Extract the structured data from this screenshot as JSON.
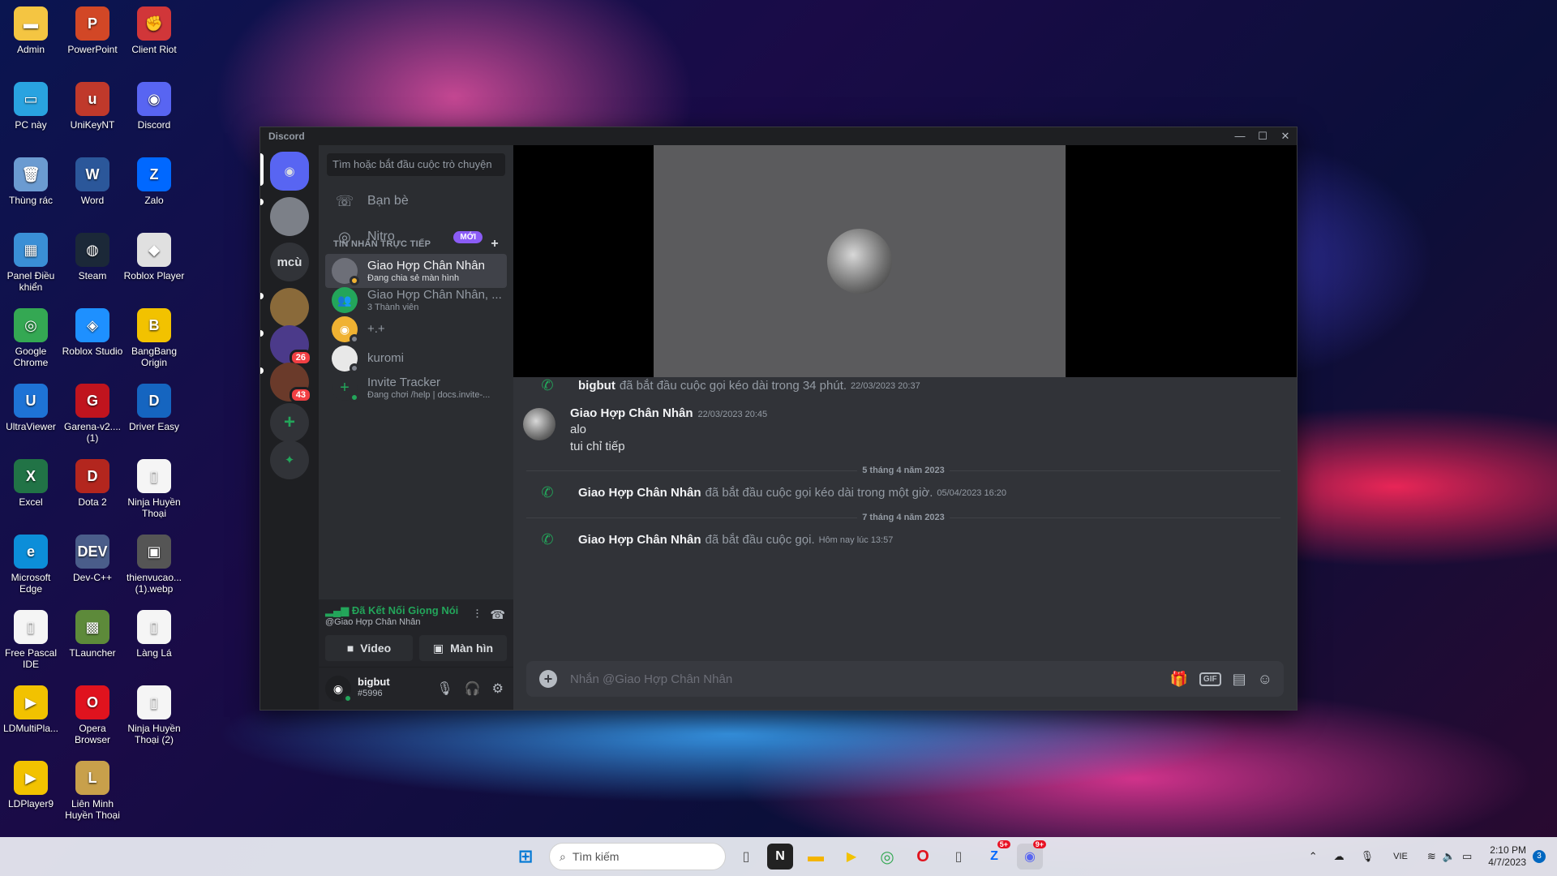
{
  "desktop": {
    "icons": [
      {
        "label": "Admin",
        "glyph": "▬",
        "color": "#f4c542"
      },
      {
        "label": "PowerPoint",
        "glyph": "P",
        "color": "#d24726"
      },
      {
        "label": "Client Riot",
        "glyph": "✊",
        "color": "#d13639"
      },
      {
        "label": "PC này",
        "glyph": "▭",
        "color": "#29a3e0"
      },
      {
        "label": "UniKeyNT",
        "glyph": "u",
        "color": "#c0392b"
      },
      {
        "label": "Discord",
        "glyph": "◉",
        "color": "#5865f2"
      },
      {
        "label": "Thùng rác",
        "glyph": "🗑",
        "color": "#6b9bd1"
      },
      {
        "label": "Word",
        "glyph": "W",
        "color": "#2b579a"
      },
      {
        "label": "Zalo",
        "glyph": "Z",
        "color": "#0068ff"
      },
      {
        "label": "Panel Điều khiển",
        "glyph": "▦",
        "color": "#3a8fd6"
      },
      {
        "label": "Steam",
        "glyph": "◍",
        "color": "#1b2838"
      },
      {
        "label": "Roblox Player",
        "glyph": "◆",
        "color": "#e0e0e0"
      },
      {
        "label": "Google Chrome",
        "glyph": "◎",
        "color": "#34a853"
      },
      {
        "label": "Roblox Studio",
        "glyph": "◈",
        "color": "#1e90ff"
      },
      {
        "label": "BangBang Origin",
        "glyph": "B",
        "color": "#f2c200"
      },
      {
        "label": "UltraViewer",
        "glyph": "U",
        "color": "#1e73d6"
      },
      {
        "label": "Garena-v2.... (1)",
        "glyph": "G",
        "color": "#c0141e"
      },
      {
        "label": "Driver Easy",
        "glyph": "D",
        "color": "#1565c0"
      },
      {
        "label": "Excel",
        "glyph": "X",
        "color": "#217346"
      },
      {
        "label": "Dota 2",
        "glyph": "D",
        "color": "#b3261e"
      },
      {
        "label": "Ninja Huyền Thoại",
        "glyph": "▯",
        "color": "#f5f5f5"
      },
      {
        "label": "Microsoft Edge",
        "glyph": "e",
        "color": "#0c8ed9"
      },
      {
        "label": "Dev-C++",
        "glyph": "DEV",
        "color": "#4a5d8a"
      },
      {
        "label": "thienvucao... (1).webp",
        "glyph": "▣",
        "color": "#555555"
      },
      {
        "label": "Free Pascal IDE",
        "glyph": "▯",
        "color": "#f5f5f5"
      },
      {
        "label": "TLauncher",
        "glyph": "▩",
        "color": "#5d8a3a"
      },
      {
        "label": "Làng Lá",
        "glyph": "▯",
        "color": "#f5f5f5"
      },
      {
        "label": "LDMultiPla...",
        "glyph": "▶",
        "color": "#f2c200"
      },
      {
        "label": "Opera Browser",
        "glyph": "O",
        "color": "#e0131e"
      },
      {
        "label": "Ninja Huyền Thoại (2)",
        "glyph": "▯",
        "color": "#f5f5f5"
      },
      {
        "label": "LDPlayer9",
        "glyph": "▶",
        "color": "#f2c200"
      },
      {
        "label": "Liên Minh Huyền Thoại",
        "glyph": "L",
        "color": "#c8a04b"
      }
    ]
  },
  "window": {
    "title": "Discord",
    "controls": {
      "minimize": "—",
      "maximize": "☐",
      "close": "✕"
    }
  },
  "servers": [
    {
      "label": "",
      "badge": "",
      "glyph": "◉",
      "color": "#5865f2"
    },
    {
      "label": "",
      "badge": "",
      "glyph": "",
      "color": "#7c8088"
    },
    {
      "label": "mcù",
      "badge": "",
      "glyph": "",
      "color": "#313338"
    },
    {
      "label": "",
      "badge": "",
      "glyph": "",
      "color": "#8a6a3a"
    },
    {
      "label": "",
      "badge": "26",
      "glyph": "",
      "color": "#4b3a8a"
    },
    {
      "label": "",
      "badge": "43",
      "glyph": "",
      "color": "#6a3a2a"
    },
    {
      "label": "",
      "badge": "",
      "glyph": "+",
      "color": "#313338"
    },
    {
      "label": "",
      "badge": "",
      "glyph": "✦",
      "color": "#313338"
    }
  ],
  "sidebar": {
    "search_placeholder": "Tìm hoặc bắt đầu cuộc trò chuyện",
    "friends_label": "Bạn bè",
    "nitro_label": "Nitro",
    "new_badge": "MỚI",
    "dm_header": "TIN NHẮN TRỰC TIẾP",
    "dm_add": "+",
    "dms": [
      {
        "name": "Giao Hợp Chân Nhân",
        "sub": "Đang chia sẻ màn hình",
        "color": "#6d6f78",
        "status": "#f0b232",
        "glyph": ""
      },
      {
        "name": "Giao Hợp Chân Nhân, ...",
        "sub": "3 Thành viên",
        "color": "#23a55a",
        "status": "",
        "glyph": "👥"
      },
      {
        "name": "+.+",
        "sub": "",
        "color": "#f0b232",
        "status": "#80848e",
        "glyph": "◉"
      },
      {
        "name": "kuromi",
        "sub": "",
        "color": "#e8e8e8",
        "status": "#80848e",
        "glyph": ""
      },
      {
        "name": "Invite Tracker",
        "sub": "Đang chơi /help | docs.invite-...",
        "color": "#2b2d31",
        "status": "#23a55a",
        "glyph": "+"
      }
    ]
  },
  "voice": {
    "status": "Đã Kết Nối Giọng Nói",
    "channel": "@Giao Hợp Chân Nhân",
    "video_label": "Video",
    "screen_label": "Màn hìn"
  },
  "user": {
    "name": "bigbut",
    "tag": "#5996"
  },
  "chat": {
    "messages": [
      {
        "kind": "system",
        "author": "bigbut",
        "text": "đã bắt đầu cuộc gọi kéo dài trong 34 phút.",
        "time": "22/03/2023 20:37"
      },
      {
        "kind": "message",
        "author": "Giao Hợp Chân Nhân",
        "time": "22/03/2023 20:45",
        "lines": [
          "alo",
          "tui chỉ tiếp"
        ]
      },
      {
        "kind": "divider",
        "text": "5 tháng 4 năm 2023"
      },
      {
        "kind": "system",
        "author": "Giao Hợp Chân Nhân",
        "text": "đã bắt đầu cuộc gọi kéo dài trong một giờ.",
        "time": "05/04/2023 16:20"
      },
      {
        "kind": "divider",
        "text": "7 tháng 4 năm 2023"
      },
      {
        "kind": "system",
        "author": "Giao Hợp Chân Nhân",
        "text": "đã bắt đầu cuộc gọi.",
        "time": "Hôm nay lúc 13:57"
      }
    ],
    "composer_placeholder": "Nhắn @Giao Hợp Chân Nhân",
    "gif_label": "GIF"
  },
  "taskbar": {
    "search_placeholder": "Tìm kiếm",
    "language": "VIE",
    "time": "2:10 PM",
    "date": "4/7/2023",
    "notifications": "3",
    "zalo_badge": "5+",
    "discord_badge": "9+"
  }
}
